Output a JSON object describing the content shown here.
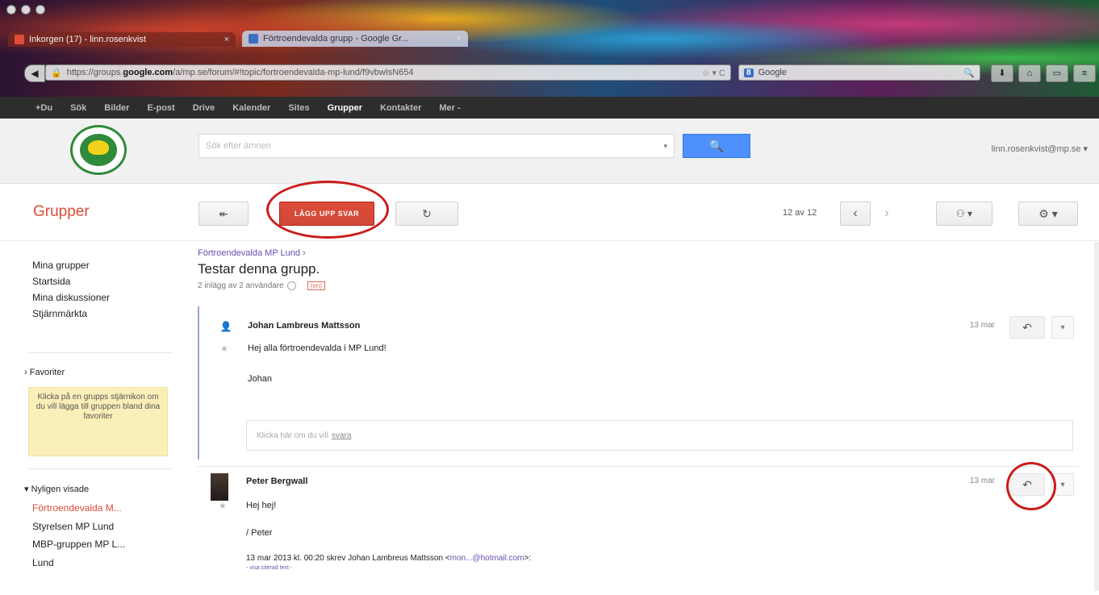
{
  "browser": {
    "tabs": [
      {
        "label": "Inkorgen (17) - linn.rosenkvist",
        "close": "×"
      },
      {
        "label": "Förtroendevalda grupp - Google Gr...",
        "close": "×"
      }
    ],
    "url": {
      "prefix": "https://groups.",
      "host": "google.com",
      "path": "/a/mp.se/forum/#!topic/fortroendevalda-mp-lund/f9vbwIsN654",
      "tail": "☆ ▾ C"
    },
    "search_engine": {
      "badge": "8",
      "label": "Google",
      "icon": "magnifier"
    },
    "back": "◀"
  },
  "google_bar": {
    "items": [
      "+Du",
      "Sök",
      "Bilder",
      "E-post",
      "Drive",
      "Kalender",
      "Sites",
      "Grupper",
      "Kontakter",
      "Mer -"
    ],
    "active": "Grupper"
  },
  "header": {
    "search_placeholder": "Sök efter ämnen",
    "search_caret": "▾",
    "search_button_icon": "🔍",
    "account": "linn.rosenkvist@mp.se ▾"
  },
  "toolbar": {
    "app_title": "Grupper",
    "back_icon": "↞",
    "new_topic_label": "LÄGG UPP SVAR",
    "refresh_icon": "↻",
    "counter": "12 av 12",
    "prev_icon": "‹",
    "next_icon": "›",
    "people_label": "⚇ ▾",
    "settings_label": "⚙ ▾"
  },
  "sidebar": {
    "nav": [
      "Mina grupper",
      "Startsida",
      "Mina diskussioner",
      "Stjärnmärkta"
    ],
    "favorites_heading": "› Favoriter",
    "favorites_hint": "Klicka på en grupps stjärnikon om du vill lägga till gruppen bland dina favoriter",
    "recent_heading": "▾ Nyligen visade",
    "recent": [
      "Förtroendevalda M...",
      "Styrelsen MP Lund",
      "MBP-gruppen MP L...",
      "Lund"
    ]
  },
  "thread": {
    "breadcrumb": "Förtroendevalda MP Lund ›",
    "title": "Testar denna grupp.",
    "meta": "2 inlägg av 2 användare",
    "meta_tag": "(en)",
    "posts": [
      {
        "author": "Johan Lambreus Mattsson",
        "date": "13 mar",
        "lines": [
          "Hej alla förtroendevalda i MP Lund!",
          "Johan"
        ],
        "reply_prompt": "Klicka här om du vill",
        "reply_link": "svara"
      },
      {
        "author": "Peter Bergwall",
        "date": "13 mar",
        "lines": [
          "Hej hej!",
          "/ Peter"
        ],
        "quote_prefix": "13 mar 2013 kl. 00:20 skrev Johan Lambreus Mattsson <",
        "quote_email": "mon...@hotmail.com",
        "quote_suffix": ">:",
        "quote_hint": "- visa citerad text -"
      }
    ],
    "reply_icon": "↶",
    "more_icon": "▾",
    "star_icon": "★",
    "person_icon": "👤"
  },
  "annotations": {
    "color": "#cc1b1b"
  }
}
